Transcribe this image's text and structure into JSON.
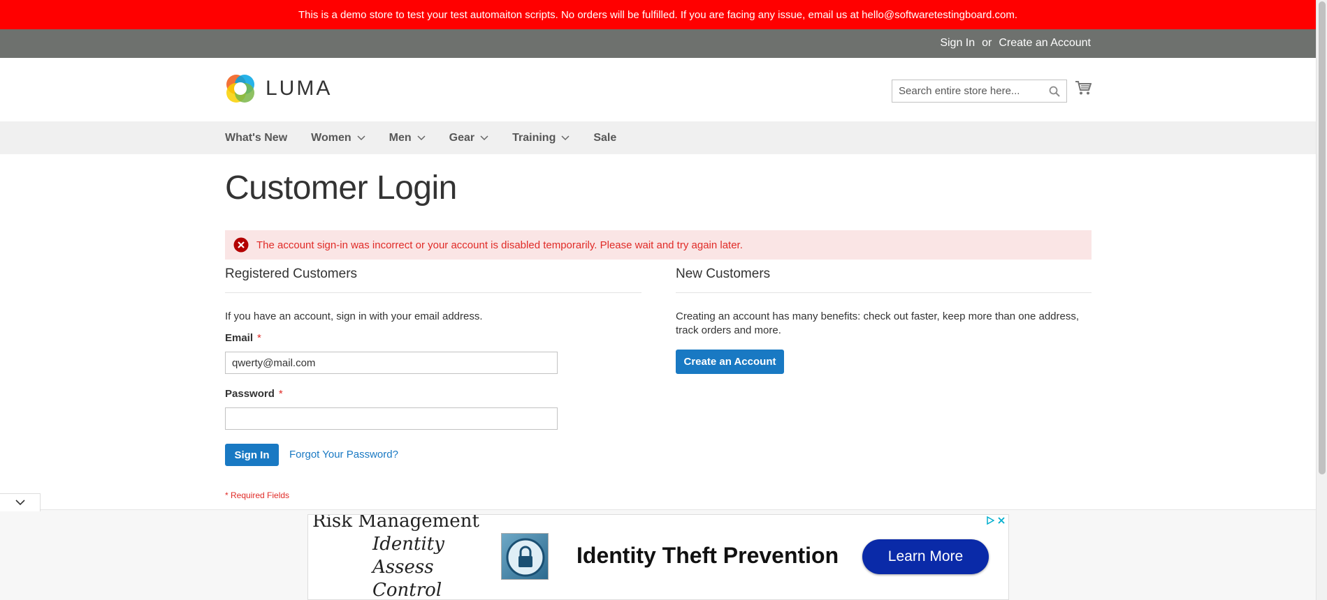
{
  "banner": {
    "text": "This is a demo store to test your test automaiton scripts. No orders will be fulfilled. If you are facing any issue, email us at hello@softwaretestingboard.com."
  },
  "topbar": {
    "sign_in": "Sign In",
    "or": "or",
    "create_account": "Create an Account"
  },
  "header": {
    "logo_text": "LUMA",
    "search_placeholder": "Search entire store here..."
  },
  "nav": {
    "items": [
      {
        "label": "What's New",
        "has_dropdown": false
      },
      {
        "label": "Women",
        "has_dropdown": true
      },
      {
        "label": "Men",
        "has_dropdown": true
      },
      {
        "label": "Gear",
        "has_dropdown": true
      },
      {
        "label": "Training",
        "has_dropdown": true
      },
      {
        "label": "Sale",
        "has_dropdown": false
      }
    ]
  },
  "page": {
    "title": "Customer Login",
    "error_message": "The account sign-in was incorrect or your account is disabled temporarily. Please wait and try again later."
  },
  "registered": {
    "title": "Registered Customers",
    "intro": "If you have an account, sign in with your email address.",
    "email_label": "Email",
    "email_value": "qwerty@mail.com",
    "password_label": "Password",
    "password_value": "",
    "required_mark": "*",
    "sign_in_button": "Sign In",
    "forgot_link": "Forgot Your Password?",
    "required_note": "* Required Fields"
  },
  "new_customers": {
    "title": "New Customers",
    "intro": "Creating an account has many benefits: check out faster, keep more than one address, track orders and more.",
    "create_button": "Create an Account"
  },
  "ad": {
    "rm_title": "Risk Management",
    "list": [
      "Identity",
      "Assess",
      "Control"
    ],
    "headline": "Identity Theft Prevention",
    "cta": "Learn More"
  },
  "colors": {
    "banner_bg": "#ff0000",
    "topbar_bg": "#6e716e",
    "primary": "#1979c3",
    "error_bg": "#fae5e5",
    "error_text": "#e02b27"
  }
}
